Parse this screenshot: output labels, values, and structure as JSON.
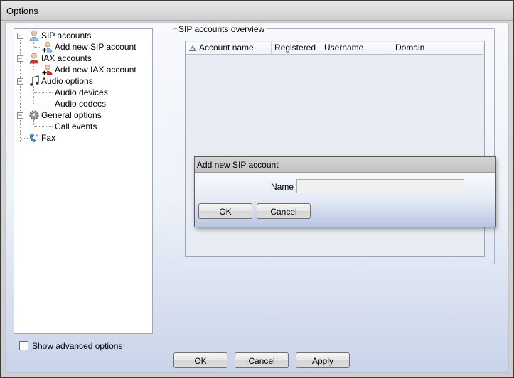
{
  "window": {
    "title": "Options"
  },
  "tree": {
    "items": [
      {
        "label": "SIP accounts",
        "icon": "sip-accounts-icon"
      },
      {
        "label": "Add new SIP account",
        "icon": "add-sip-account-icon"
      },
      {
        "label": "IAX accounts",
        "icon": "iax-accounts-icon"
      },
      {
        "label": "Add new IAX account",
        "icon": "add-iax-account-icon"
      },
      {
        "label": "Audio options",
        "icon": "music-note-icon"
      },
      {
        "label": "Audio devices"
      },
      {
        "label": "Audio codecs"
      },
      {
        "label": "General options",
        "icon": "gear-icon"
      },
      {
        "label": "Call events"
      },
      {
        "label": "Fax",
        "icon": "fax-icon"
      }
    ]
  },
  "advanced": {
    "label": "Show advanced options",
    "checked": false
  },
  "overview": {
    "title": "SIP accounts overview",
    "columns": [
      "Account name",
      "Registered",
      "Username",
      "Domain"
    ]
  },
  "dialog": {
    "title": "Add new SIP account",
    "name_label": "Name",
    "name_value": "",
    "ok": "OK",
    "cancel": "Cancel"
  },
  "footer": {
    "ok": "OK",
    "cancel": "Cancel",
    "apply": "Apply"
  },
  "colors": {
    "accent": "#4a6fa5",
    "gradient_bottom": "#c9d4ea"
  }
}
